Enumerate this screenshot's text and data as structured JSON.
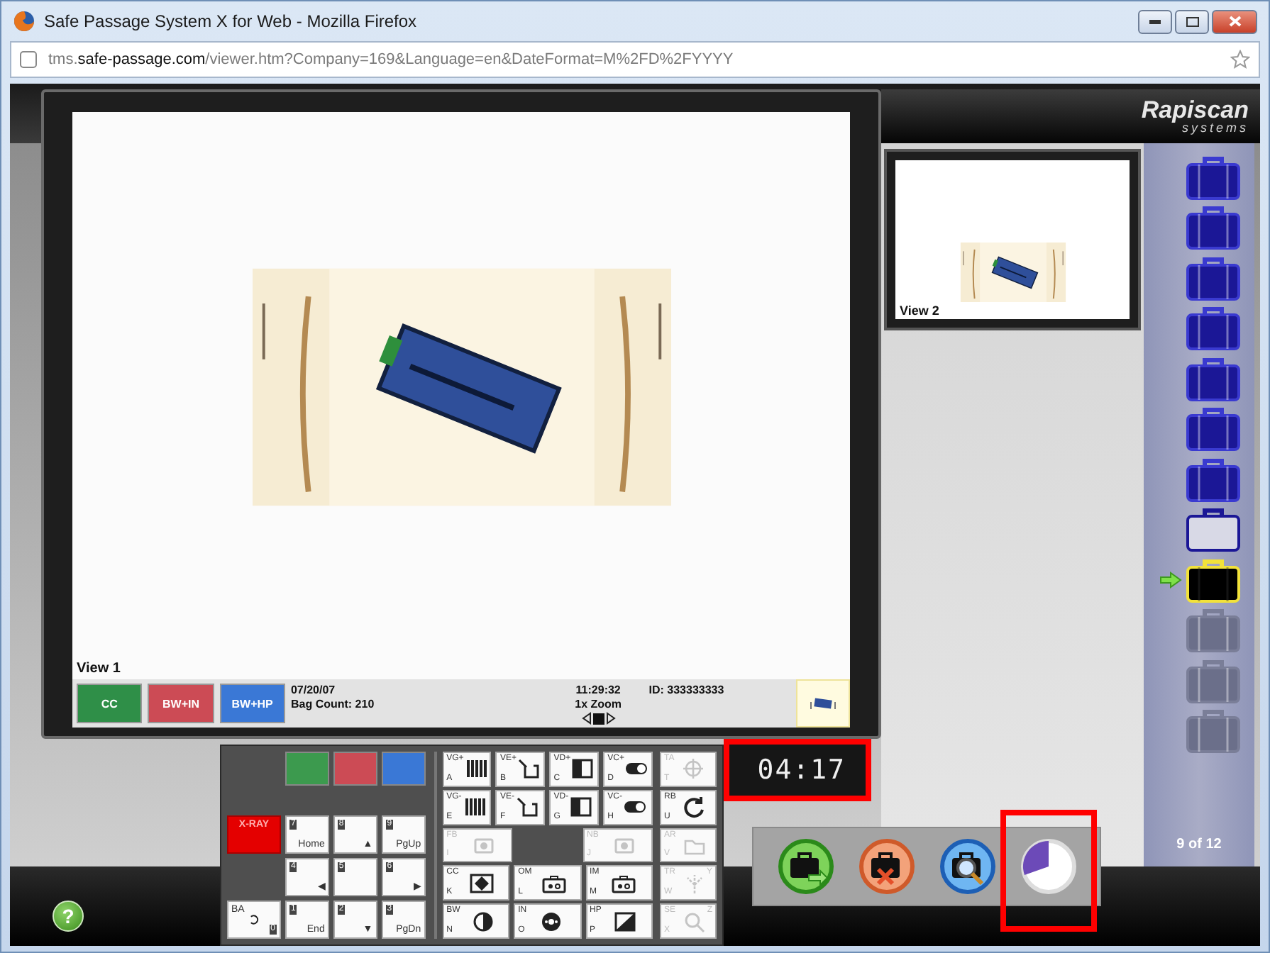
{
  "window": {
    "title": "Safe Passage System X for Web - Mozilla Firefox"
  },
  "address_bar": {
    "url": "tms.**safe-passage.com**/viewer.htm?Company=169&Language=en&DateFormat=M%2FD%2FYYYY"
  },
  "main_view": {
    "label": "View 1",
    "filters": [
      {
        "label": "CC",
        "color": "#2f8f48"
      },
      {
        "label": "BW+IN",
        "color": "#cc4b55"
      },
      {
        "label": "BW+HP",
        "color": "#3a78d6"
      }
    ],
    "date": "07/20/07",
    "bag_count": "Bag Count: 210",
    "time": "11:29:32",
    "zoom": "1x Zoom",
    "id": "ID: 333333333"
  },
  "logo": {
    "brand": "Rapiscan",
    "sub": "systems"
  },
  "thumbnail": {
    "label": "View 2"
  },
  "bags": [
    {
      "kind": "cleared"
    },
    {
      "kind": "cleared"
    },
    {
      "kind": "cleared"
    },
    {
      "kind": "cleared"
    },
    {
      "kind": "cleared"
    },
    {
      "kind": "cleared"
    },
    {
      "kind": "cleared"
    },
    {
      "kind": "empty"
    },
    {
      "kind": "current"
    },
    {
      "kind": "pending"
    },
    {
      "kind": "pending"
    },
    {
      "kind": "pending"
    }
  ],
  "bag_position": "9 of 12",
  "timer": {
    "value": "04:17",
    "highlighted": true
  },
  "keypad": {
    "color_keys": [
      {
        "color": "#3c9a4e"
      },
      {
        "color": "#cc4b55"
      },
      {
        "color": "#3a78d6"
      }
    ],
    "nav_keys": [
      {
        "kind": "xray",
        "label": "X-RAY"
      },
      {
        "kind": "key",
        "number": "7",
        "label": "Home"
      },
      {
        "kind": "key",
        "number": "8",
        "label": "▲"
      },
      {
        "kind": "key",
        "number": "9",
        "label": "PgUp"
      },
      {
        "kind": "blank"
      },
      {
        "kind": "key",
        "number": "4",
        "label": "◀"
      },
      {
        "kind": "key",
        "number": "5"
      },
      {
        "kind": "key",
        "number": "6",
        "label": "▶"
      },
      {
        "kind": "back",
        "number": "0",
        "label": "BA"
      },
      {
        "kind": "key",
        "number": "1",
        "label": "End"
      },
      {
        "kind": "key",
        "number": "2",
        "label": "▼"
      },
      {
        "kind": "key",
        "number": "3",
        "label": "PgDn"
      }
    ],
    "function_rows": [
      [
        {
          "kind": "bars",
          "code": "VG+",
          "letter": "A",
          "disabled": false
        },
        {
          "kind": "crop",
          "code": "VE+",
          "letter": "B",
          "disabled": false
        },
        {
          "kind": "split",
          "code": "VD+",
          "letter": "C",
          "disabled": false
        },
        {
          "kind": "toggle",
          "code": "VC+",
          "letter": "D",
          "disabled": false
        }
      ],
      [
        {
          "kind": "bars",
          "code": "VG-",
          "letter": "E",
          "disabled": false
        },
        {
          "kind": "crop",
          "code": "VE-",
          "letter": "F",
          "disabled": false
        },
        {
          "kind": "split",
          "code": "VD-",
          "letter": "G",
          "disabled": false
        },
        {
          "kind": "toggle",
          "code": "VC-",
          "letter": "H",
          "disabled": false
        }
      ],
      [
        {
          "kind": "camera",
          "code": "FB",
          "letter": "I",
          "disabled": true
        },
        {
          "kind": "blank"
        },
        {
          "kind": "camera",
          "code": "NB",
          "letter": "J",
          "disabled": true
        }
      ],
      [
        {
          "kind": "grid",
          "code": "CC",
          "letter": "K",
          "disabled": false
        },
        {
          "kind": "bag",
          "code": "OM",
          "letter": "L",
          "disabled": false
        },
        {
          "kind": "bag",
          "code": "IM",
          "letter": "M",
          "disabled": false
        }
      ],
      [
        {
          "kind": "half",
          "code": "BW",
          "letter": "N",
          "disabled": false
        },
        {
          "kind": "dots",
          "code": "IN",
          "letter": "O",
          "disabled": false
        },
        {
          "kind": "diag",
          "code": "HP",
          "letter": "P",
          "disabled": false
        }
      ]
    ],
    "side_keys": [
      {
        "kind": "target",
        "code": "TA",
        "letter": "T",
        "disabled": true
      },
      {
        "kind": "rotate",
        "code": "RB",
        "letter": "U",
        "disabled": false
      },
      {
        "kind": "folder",
        "code": "AR",
        "letter": "V",
        "disabled": true
      },
      {
        "kind": "tree",
        "code": "TR",
        "letter": "W",
        "alt": "Y",
        "disabled": true
      },
      {
        "kind": "magnifier",
        "code": "SE",
        "letter": "X",
        "alt": "Z",
        "disabled": true
      }
    ]
  },
  "actions": [
    {
      "kind": "clear",
      "highlighted": false
    },
    {
      "kind": "reject",
      "highlighted": false
    },
    {
      "kind": "inspect",
      "highlighted": false
    },
    {
      "kind": "timer",
      "highlighted": true
    }
  ],
  "help": {
    "label": "?"
  }
}
